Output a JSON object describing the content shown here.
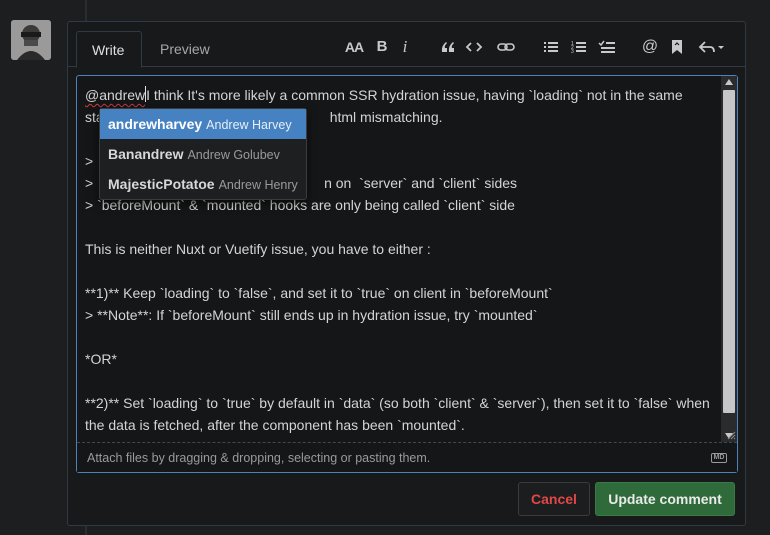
{
  "tabs": {
    "write": "Write",
    "preview": "Preview"
  },
  "toolbar": {
    "heading": "AA",
    "bold": "B",
    "italic": "i",
    "quote": "quote-icon",
    "code": "code-icon",
    "link": "link-icon",
    "unordered_list": "unordered-list-icon",
    "ordered_list": "ordered-list-icon",
    "task_list": "task-list-icon",
    "mention": "@",
    "saved_replies": "bookmark-icon",
    "reply": "reply-icon"
  },
  "editor": {
    "mention_typed": "@andrew",
    "line1_rest": "I think It's more likely a common SSR hydration issue, having `loading` not in the same",
    "line2_visible_start": "sta",
    "line2_visible_end": "html mismatching.",
    "line4_start": "> ",
    "line5_start": "> ",
    "line5_end": "n on  `server` and `client` sides",
    "line6": "> `beforeMount` & `mounted` hooks are only being called `client` side",
    "line8": "This is neither Nuxt or Vuetify issue, you have to either :",
    "line10": "**1)** Keep `loading` to `false`, and set it to `true` on client in `beforeMount`",
    "line11": "> **Note**: If `beforeMount` still ends up in hydration issue, try `mounted`",
    "line13": "*OR*",
    "line15": "**2)** Set `loading` to `true` by default in `data` (so both `client` & `server`), then set it to `false` when",
    "line16": "the data is fetched, after the component has been `mounted`."
  },
  "mention_menu": [
    {
      "login": "andrewharvey",
      "name": "Andrew Harvey",
      "selected": true
    },
    {
      "login": "Banandrew",
      "name": "Andrew Golubev",
      "selected": false
    },
    {
      "login": "MajesticPotatoe",
      "name": "Andrew Henry",
      "selected": false
    }
  ],
  "attach_hint": "Attach files by dragging & dropping, selecting or pasting them.",
  "markdown_badge": "MD",
  "buttons": {
    "cancel": "Cancel",
    "update": "Update comment"
  },
  "colors": {
    "accent": "#4682c2",
    "danger": "#e04848",
    "success_bg": "#2f6b3a"
  }
}
